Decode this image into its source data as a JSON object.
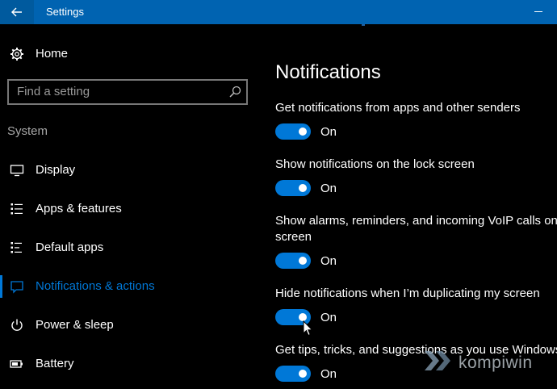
{
  "window": {
    "title": "Settings",
    "accent": "#0063b1"
  },
  "sidebar": {
    "home_label": "Home",
    "search_placeholder": "Find a setting",
    "section": "System",
    "items": [
      {
        "label": "Display",
        "icon": "display-icon"
      },
      {
        "label": "Apps & features",
        "icon": "apps-list-icon"
      },
      {
        "label": "Default apps",
        "icon": "default-apps-icon"
      },
      {
        "label": "Notifications & actions",
        "icon": "notifications-icon",
        "active": true
      },
      {
        "label": "Power & sleep",
        "icon": "power-icon"
      },
      {
        "label": "Battery",
        "icon": "battery-icon"
      }
    ]
  },
  "main": {
    "title": "Notifications",
    "settings": [
      {
        "label": "Get notifications from apps and other senders",
        "state": "On"
      },
      {
        "label": "Show notifications on the lock screen",
        "state": "On"
      },
      {
        "label_line1": "Show alarms, reminders, and incoming VoIP calls on t",
        "label_line2": "screen",
        "state": "On"
      },
      {
        "label": "Hide notifications when I’m duplicating my screen",
        "state": "On"
      },
      {
        "label": "Get tips, tricks, and suggestions as you use Windows",
        "state": "On"
      }
    ]
  },
  "watermark": {
    "text": "kompiwin"
  },
  "colors": {
    "toggle_on": "#0078d7",
    "active_nav": "#0078d7"
  }
}
